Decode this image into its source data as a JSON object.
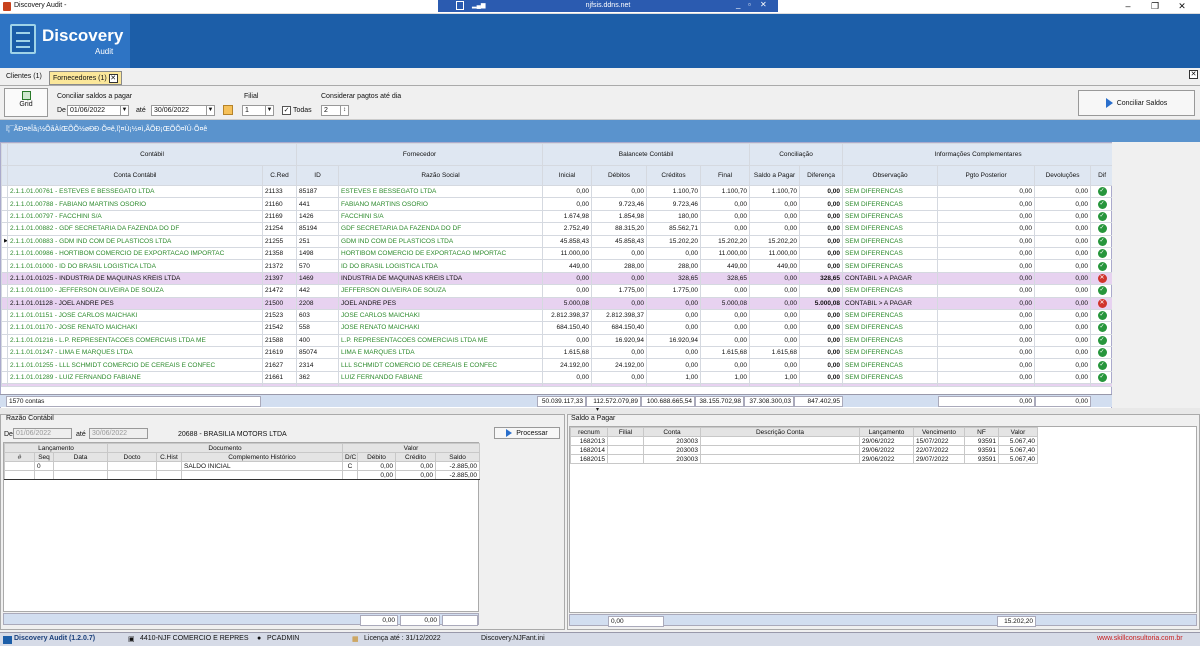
{
  "app": {
    "window_title": "Discovery Audit -",
    "remote_host": "njfsis.ddns.net",
    "brand_name": "Discovery",
    "brand_sub": "Audit"
  },
  "tabs": [
    {
      "label": "Clientes (1)"
    },
    {
      "label": "Fornecedores (1)"
    }
  ],
  "filters": {
    "grid_label": "Grid",
    "conciliar_label": "Conciliar saldos a pagar",
    "de_label": "De",
    "date_from": "01/06/2022",
    "ate_label": "até",
    "date_to": "30/06/2022",
    "filial_label": "Filial",
    "filial_value": "1",
    "todas_label": "Todas",
    "considerar_label": "Considerar pagtos até dia",
    "dia_value": "2",
    "conciliar_button": "Conciliar Saldos"
  },
  "blue_strip_text": "Ï¦¯ÃÐ¤ëÎå¡½ÕåÀíŒÕÕ½øÐÐ·Õ¤ê,Ï¦¤Ù¡½¤ì,ÃÕÐ¡ŒÕÕ¤ÏÛ·Õ¤ê",
  "grid": {
    "group_headers": [
      "Contábil",
      "Fornecedor",
      "Balancete Contábil",
      "Conciliação",
      "Informações Complementares"
    ],
    "columns": [
      "Conta Contábil",
      "C.Red",
      "ID",
      "Razão Social",
      "Inicial",
      "Débitos",
      "Créditos",
      "Final",
      "Saldo a Pagar",
      "Diferença",
      "Observação",
      "Pgto Posterior",
      "Devoluções",
      "Dif"
    ],
    "rows": [
      [
        "2.1.1.01.00761 - ESTEVES E BESSEGATO LTDA",
        "21133",
        "85187",
        "ESTEVES E BESSEGATO LTDA",
        "0,00",
        "0,00",
        "1.100,70",
        "1.100,70",
        "1.100,70",
        "0,00",
        "SEM DIFERENCAS",
        "0,00",
        "0,00",
        "ok",
        "normal"
      ],
      [
        "2.1.1.01.00788 - FABIANO MARTINS OSORIO",
        "21160",
        "441",
        "FABIANO MARTINS OSORIO",
        "0,00",
        "9.723,46",
        "9.723,46",
        "0,00",
        "0,00",
        "0,00",
        "SEM DIFERENCAS",
        "0,00",
        "0,00",
        "ok",
        "normal"
      ],
      [
        "2.1.1.01.00797 - FACCHINI S/A",
        "21169",
        "1426",
        "FACCHINI S/A",
        "1.674,98",
        "1.854,98",
        "180,00",
        "0,00",
        "0,00",
        "0,00",
        "SEM DIFERENCAS",
        "0,00",
        "0,00",
        "ok",
        "normal"
      ],
      [
        "2.1.1.01.00882 - GDF SECRETARIA DA FAZENDA DO DF",
        "21254",
        "85194",
        "GDF SECRETARIA DA FAZENDA DO DF",
        "2.752,49",
        "88.315,20",
        "85.562,71",
        "0,00",
        "0,00",
        "0,00",
        "SEM DIFERENCAS",
        "0,00",
        "0,00",
        "ok",
        "normal"
      ],
      [
        "2.1.1.01.00883 - GDM IND COM DE PLASTICOS LTDA",
        "21255",
        "251",
        "GDM IND COM DE PLASTICOS LTDA",
        "45.858,43",
        "45.858,43",
        "15.202,20",
        "15.202,20",
        "15.202,20",
        "0,00",
        "SEM DIFERENCAS",
        "0,00",
        "0,00",
        "ok",
        "selected"
      ],
      [
        "2.1.1.01.00986 - HORTIBOM COMERCIO DE EXPORTACAO IMPORTAC",
        "21358",
        "1498",
        "HORTIBOM COMERCIO DE EXPORTACAO IMPORTAC",
        "11.000,00",
        "0,00",
        "0,00",
        "11.000,00",
        "11.000,00",
        "0,00",
        "SEM DIFERENCAS",
        "0,00",
        "0,00",
        "ok",
        "normal"
      ],
      [
        "2.1.1.01.01000 - ID DO BRASIL LOGISTICA LTDA",
        "21372",
        "570",
        "ID DO BRASIL LOGISTICA LTDA",
        "449,00",
        "288,00",
        "288,00",
        "449,00",
        "449,00",
        "0,00",
        "SEM DIFERENCAS",
        "0,00",
        "0,00",
        "ok",
        "normal"
      ],
      [
        "2.1.1.01.01025 - INDUSTRIA DE MAQUINAS KREIS LTDA",
        "21397",
        "1469",
        "INDUSTRIA DE MAQUINAS KREIS LTDA",
        "0,00",
        "0,00",
        "328,65",
        "328,65",
        "0,00",
        "328,65",
        "CONTABIL > A PAGAR",
        "0,00",
        "0,00",
        "bad",
        "purple"
      ],
      [
        "2.1.1.01.01100 - JEFFERSON OLIVEIRA DE SOUZA",
        "21472",
        "442",
        "JEFFERSON OLIVEIRA DE SOUZA",
        "0,00",
        "1.775,00",
        "1.775,00",
        "0,00",
        "0,00",
        "0,00",
        "SEM DIFERENCAS",
        "0,00",
        "0,00",
        "ok",
        "normal"
      ],
      [
        "2.1.1.01.01128 - JOEL ANDRE PES",
        "21500",
        "2208",
        "JOEL ANDRE PES",
        "5.000,08",
        "0,00",
        "0,00",
        "5.000,08",
        "0,00",
        "5.000,08",
        "CONTABIL > A PAGAR",
        "0,00",
        "0,00",
        "bad",
        "purple"
      ],
      [
        "2.1.1.01.01151 - JOSE CARLOS MAICHAKI",
        "21523",
        "603",
        "JOSE CARLOS MAICHAKI",
        "2.812.398,37",
        "2.812.398,37",
        "0,00",
        "0,00",
        "0,00",
        "0,00",
        "SEM DIFERENCAS",
        "0,00",
        "0,00",
        "ok",
        "normal"
      ],
      [
        "2.1.1.01.01170 - JOSE RENATO MAICHAKI",
        "21542",
        "558",
        "JOSE RENATO MAICHAKI",
        "684.150,40",
        "684.150,40",
        "0,00",
        "0,00",
        "0,00",
        "0,00",
        "SEM DIFERENCAS",
        "0,00",
        "0,00",
        "ok",
        "normal"
      ],
      [
        "2.1.1.01.01216 - L.P. REPRESENTACOES COMERCIAIS LTDA ME",
        "21588",
        "400",
        "L.P. REPRESENTACOES COMERCIAIS LTDA ME",
        "0,00",
        "16.920,94",
        "16.920,94",
        "0,00",
        "0,00",
        "0,00",
        "SEM DIFERENCAS",
        "0,00",
        "0,00",
        "ok",
        "normal"
      ],
      [
        "2.1.1.01.01247 - LIMA E MARQUES LTDA",
        "21619",
        "85074",
        "LIMA E MARQUES LTDA",
        "1.615,68",
        "0,00",
        "0,00",
        "1.615,68",
        "1.615,68",
        "0,00",
        "SEM DIFERENCAS",
        "0,00",
        "0,00",
        "ok",
        "normal"
      ],
      [
        "2.1.1.01.01255 - LLL SCHMIDT COMERCIO DE CEREAIS E CONFEC",
        "21627",
        "2314",
        "LLL SCHMIDT COMERCIO DE CEREAIS E CONFEC",
        "24.192,00",
        "24.192,00",
        "0,00",
        "0,00",
        "0,00",
        "0,00",
        "SEM DIFERENCAS",
        "0,00",
        "0,00",
        "ok",
        "normal"
      ],
      [
        "2.1.1.01.01289 - LUIZ FERNANDO FABIANE",
        "21661",
        "362",
        "LUIZ FERNANDO FABIANE",
        "0,00",
        "0,00",
        "1,00",
        "1,00",
        "1,00",
        "0,00",
        "SEM DIFERENCAS",
        "0,00",
        "0,00",
        "ok",
        "normal"
      ]
    ],
    "totals": {
      "count": "1570 contas",
      "inicial": "50.039.117,33",
      "debitos": "112.572.079,89",
      "creditos": "100.688.665,54",
      "final": "38.155.702,98",
      "saldo": "37.308.300,03",
      "diferenca": "847.402,95",
      "pgto": "0,00",
      "devol": "0,00"
    }
  },
  "razao": {
    "title": "Razão Contábil",
    "de_label": "De",
    "date_from": "01/06/2022",
    "ate_label": "até",
    "date_to": "30/06/2022",
    "fornecedor": "20688 - BRASILIA MOTORS LTDA",
    "processar": "Processar",
    "group_headers": [
      "Lançamento",
      "Documento",
      "Valor"
    ],
    "columns": [
      "#",
      "Seq",
      "Data",
      "Docto",
      "C.Hist",
      "Complemento Histórico",
      "D/C",
      "Débito",
      "Crédito",
      "Saldo"
    ],
    "rows": [
      [
        "",
        "0",
        "",
        "",
        "",
        "SALDO INICIAL",
        "C",
        "0,00",
        "0,00",
        "-2.885,00"
      ]
    ],
    "subtotal": {
      "debito": "0,00",
      "credito": "0,00",
      "saldo": "-2.885,00"
    },
    "footer": {
      "debito": "0,00",
      "credito": "0,00"
    }
  },
  "saldo_pagar": {
    "title": "Saldo a Pagar",
    "columns": [
      "recnum",
      "Filial",
      "Conta",
      "Descrição Conta",
      "Lançamento",
      "Vencimento",
      "NF",
      "Valor"
    ],
    "rows": [
      [
        "1682013",
        "",
        "203003",
        "",
        "29/06/2022",
        "15/07/2022",
        "93591",
        "5.067,40"
      ],
      [
        "1682014",
        "",
        "203003",
        "",
        "29/06/2022",
        "22/07/2022",
        "93591",
        "5.067,40"
      ],
      [
        "1682015",
        "",
        "203003",
        "",
        "29/06/2022",
        "29/07/2022",
        "93591",
        "5.067,40"
      ]
    ],
    "footer": {
      "left": "0,00",
      "total": "15.202,20"
    }
  },
  "status": {
    "app_version": "Discovery Audit (1.2.0.7)",
    "empresa": "4410-NJF COMERCIO E REPRES",
    "user": "PCADMIN",
    "licenca": "Licença até : 31/12/2022",
    "ini": "Discovery.NJFant.ini",
    "site": "www.skillconsultoria.com.br"
  },
  "colors": {
    "brand": "#1c5ea8",
    "accent": "#5a93cd",
    "ok": "#27963c",
    "bad": "#d0342c",
    "purple_row": "#e7d2f0",
    "green_text": "#2c8a2c"
  }
}
